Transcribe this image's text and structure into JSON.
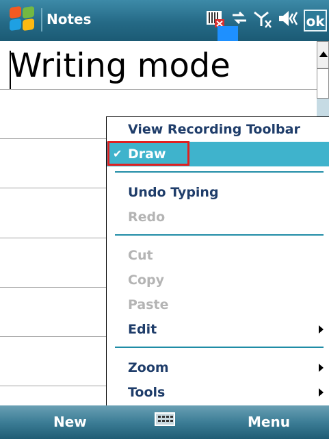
{
  "titlebar": {
    "app_title": "Notes",
    "start_icon": "windows-flag-icon",
    "status_icons": [
      "notification-icon",
      "connectivity-icon",
      "signal-icon",
      "volume-icon"
    ],
    "ok_label": "ok"
  },
  "note": {
    "title": "Writing mode"
  },
  "menu": {
    "items": [
      {
        "label": "View Recording Toolbar",
        "enabled": true
      },
      {
        "label": "Draw",
        "enabled": true,
        "checked": true,
        "selected": true
      },
      {
        "label": "Undo Typing",
        "enabled": true
      },
      {
        "label": "Redo",
        "enabled": false
      },
      {
        "label": "Cut",
        "enabled": false
      },
      {
        "label": "Copy",
        "enabled": false
      },
      {
        "label": "Paste",
        "enabled": false
      },
      {
        "label": "Edit",
        "enabled": true,
        "submenu": true
      },
      {
        "label": "Zoom",
        "enabled": true,
        "submenu": true
      },
      {
        "label": "Tools",
        "enabled": true,
        "submenu": true
      }
    ],
    "checkmark": "✔"
  },
  "softbar": {
    "left_label": "New",
    "right_label": "Menu",
    "center_icon": "keyboard-icon"
  },
  "colors": {
    "titlebar": "#256a86",
    "menu_highlight": "#3fb3cc",
    "menu_text": "#1f3d6a",
    "disabled_text": "#b4b4b4",
    "annotation_box": "#e02020"
  }
}
